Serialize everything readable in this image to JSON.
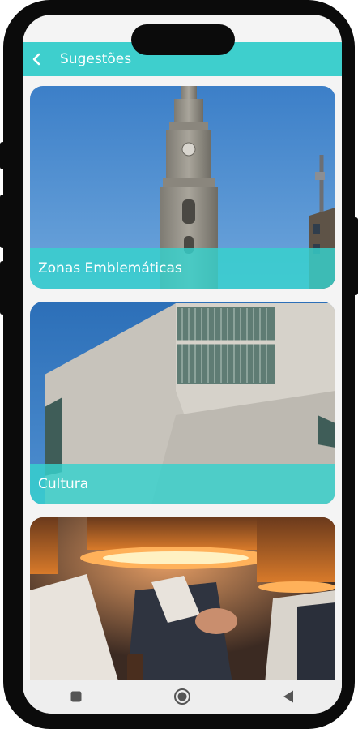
{
  "app_bar": {
    "title": "Sugestões",
    "back_icon": "chevron-left-icon"
  },
  "cards": [
    {
      "label": "Zonas Emblemáticas"
    },
    {
      "label": "Cultura"
    },
    {
      "label": ""
    }
  ],
  "nav": {
    "square": "square-icon",
    "home": "circle-icon",
    "back": "triangle-back-icon"
  },
  "colors": {
    "accent": "#3ecfcd",
    "frame": "#0b0b0b"
  }
}
